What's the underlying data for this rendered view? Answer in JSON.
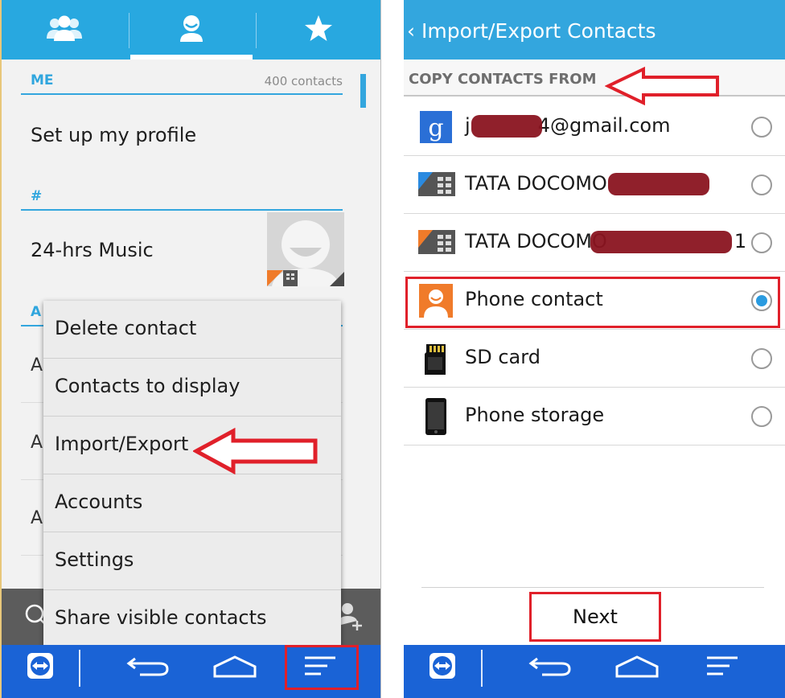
{
  "left_screen": {
    "tabs": [
      {
        "icon": "groups-icon"
      },
      {
        "icon": "person-icon",
        "selected": true
      },
      {
        "icon": "star-icon"
      }
    ],
    "me_section": {
      "title": "ME",
      "count": "400 contacts"
    },
    "profile_row": "Set up my profile",
    "hash_section": "#",
    "contact_row": "24-hrs Music",
    "letter_section": "A",
    "letters": [
      "A",
      "A",
      "A"
    ],
    "menu": {
      "items": [
        "Delete contact",
        "Contacts to display",
        "Import/Export",
        "Accounts",
        "Settings",
        "Share visible contacts"
      ],
      "highlighted": "Import/Export"
    },
    "nav": {
      "icons": [
        "teamviewer-icon",
        "back-icon",
        "home-icon",
        "menu-icon"
      ]
    }
  },
  "right_screen": {
    "title": "Import/Export Contacts",
    "copy_header": "COPY CONTACTS FROM",
    "options": [
      {
        "label_start": "j",
        "label_end": "4@gmail.com",
        "icon": "google-icon",
        "selected": false
      },
      {
        "label_start": "TATA DOCOMO",
        "label_end": "",
        "icon": "sim-card-icon",
        "selected": false
      },
      {
        "label_start": "TATA DOCOMO",
        "label_end": "1",
        "icon": "sim-card-icon",
        "selected": false
      },
      {
        "label_start": "Phone contact",
        "label_end": "",
        "icon": "phone-contact-icon",
        "selected": true
      },
      {
        "label_start": "SD card",
        "label_end": "",
        "icon": "sd-card-icon",
        "selected": false
      },
      {
        "label_start": "Phone storage",
        "label_end": "",
        "icon": "phone-storage-icon",
        "selected": false
      }
    ],
    "next_label": "Next",
    "nav": {
      "icons": [
        "teamviewer-icon",
        "back-icon",
        "home-icon",
        "menu-icon"
      ]
    }
  },
  "colors": {
    "accent": "#33a6de",
    "nav_bar": "#1a63d6",
    "highlight": "#e0202a"
  }
}
